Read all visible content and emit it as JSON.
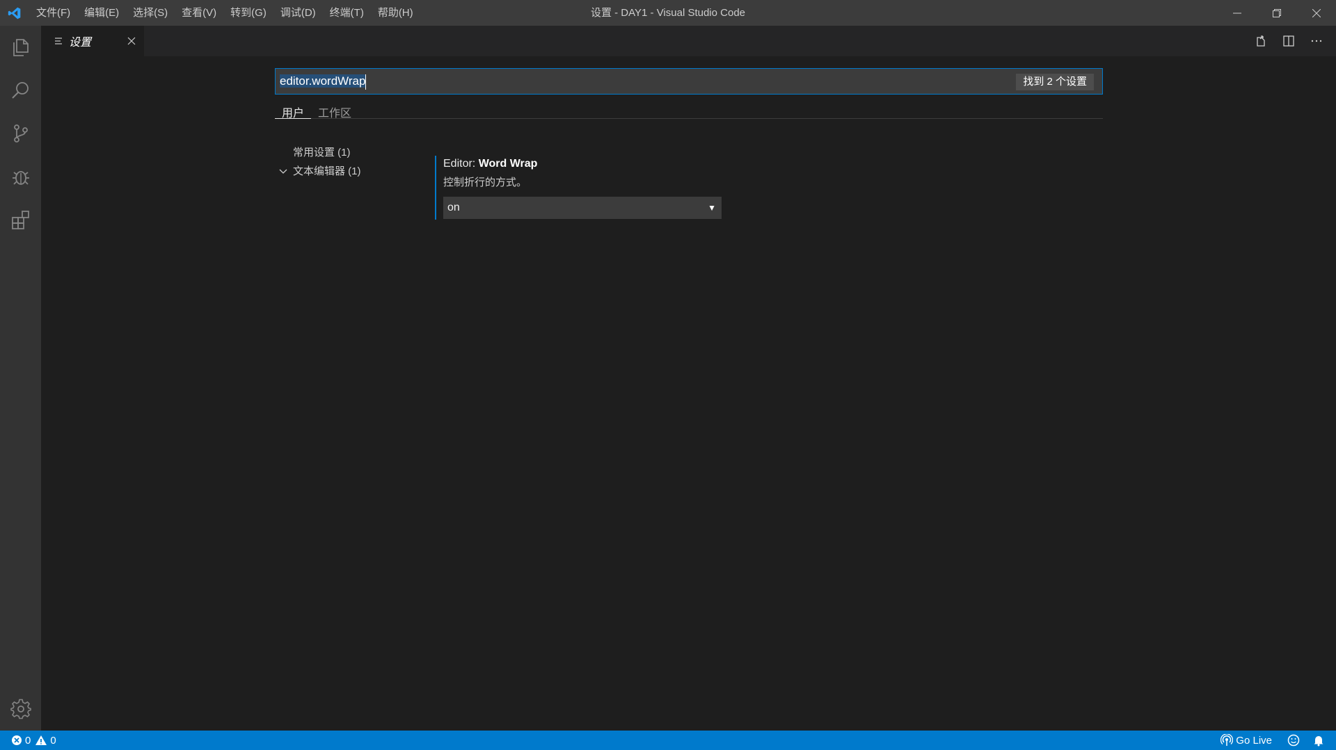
{
  "window": {
    "title": "设置 - DAY1 - Visual Studio Code"
  },
  "menu": [
    {
      "label": "文件(F)"
    },
    {
      "label": "编辑(E)"
    },
    {
      "label": "选择(S)"
    },
    {
      "label": "查看(V)"
    },
    {
      "label": "转到(G)"
    },
    {
      "label": "调试(D)"
    },
    {
      "label": "终端(T)"
    },
    {
      "label": "帮助(H)"
    }
  ],
  "tabs": [
    {
      "label": "设置",
      "icon": "settings-list-icon"
    }
  ],
  "settings": {
    "search_value": "editor.wordWrap",
    "result_count": "找到 2 个设置",
    "scopes": [
      {
        "label": "用户",
        "active": true
      },
      {
        "label": "工作区",
        "active": false
      }
    ],
    "toc": [
      {
        "label": "常用设置 (1)"
      },
      {
        "label": "文本编辑器 (1)"
      }
    ],
    "item": {
      "category": "Editor: ",
      "name": "Word Wrap",
      "description": "控制折行的方式。",
      "value": "on"
    }
  },
  "status": {
    "errors": "0",
    "warnings": "0",
    "go_live": "Go Live"
  },
  "colors": {
    "accent": "#007acc",
    "titlebar": "#3c3c3c",
    "activitybar": "#333333",
    "editor_bg": "#1e1e1e"
  }
}
